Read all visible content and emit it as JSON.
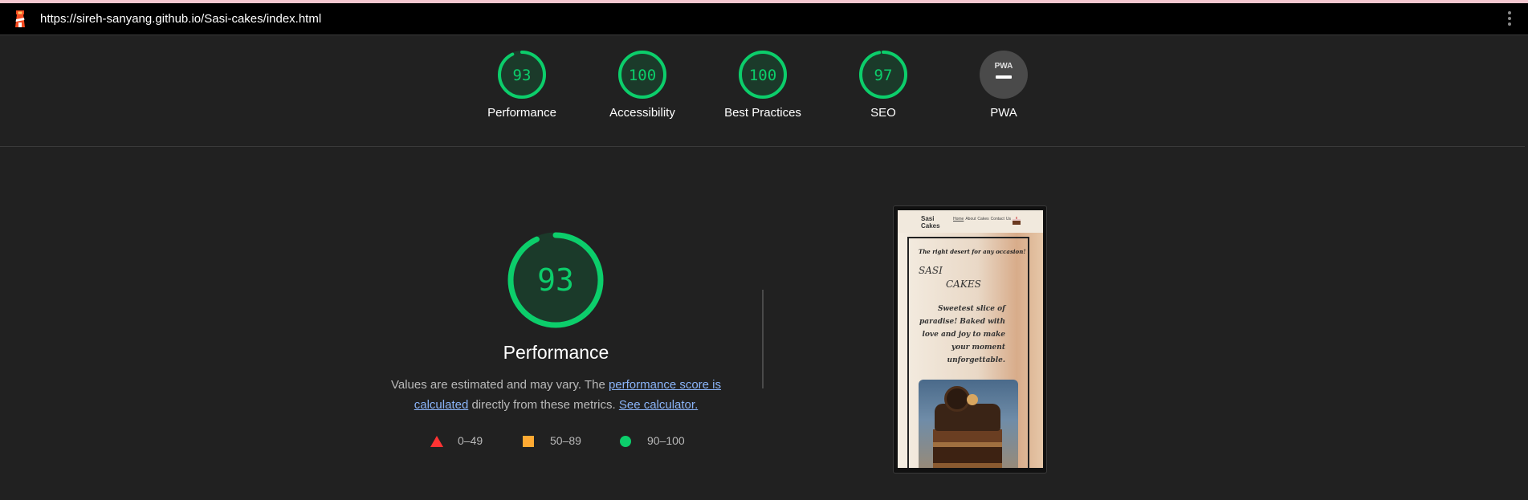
{
  "url_bar": {
    "url": "https://sireh-sanyang.github.io/Sasi-cakes/index.html",
    "logo_icon": "lighthouse-icon",
    "menu_icon": "more-vert-icon"
  },
  "scores": [
    {
      "label": "Performance",
      "score": "93",
      "fraction": 0.93
    },
    {
      "label": "Accessibility",
      "score": "100",
      "fraction": 1.0
    },
    {
      "label": "Best Practices",
      "score": "100",
      "fraction": 1.0
    },
    {
      "label": "SEO",
      "score": "97",
      "fraction": 0.97
    },
    {
      "label": "PWA",
      "score": "",
      "badge": "PWA"
    }
  ],
  "performance": {
    "score": "93",
    "title": "Performance",
    "desc_prefix": "Values are estimated and may vary. The ",
    "link_score": "performance score is calculated",
    "desc_mid": " directly from these metrics. ",
    "link_calc": "See calculator.",
    "legend": [
      {
        "range": "0–49",
        "shape": "triangle",
        "color": "#ff3333"
      },
      {
        "range": "50–89",
        "shape": "square",
        "color": "#ffaa33"
      },
      {
        "range": "90–100",
        "shape": "circle",
        "color": "#0cce6b"
      }
    ]
  },
  "thumbnail": {
    "brand_line1": "Sasi",
    "brand_line2": "Cakes",
    "nav_links": [
      "Home",
      "About",
      "Cakes",
      "Contact",
      "Us"
    ],
    "tagline": "The right desert for any occasion!",
    "heading_line1": "SASI",
    "heading_line2": "CAKES",
    "body": "Sweetest slice of paradise! Baked with love and joy to make your moment unforgettable."
  },
  "colors": {
    "pass": "#0cce6b",
    "average": "#ffaa33",
    "fail": "#ff3333",
    "link": "#8ab4f8",
    "background": "#212121"
  }
}
